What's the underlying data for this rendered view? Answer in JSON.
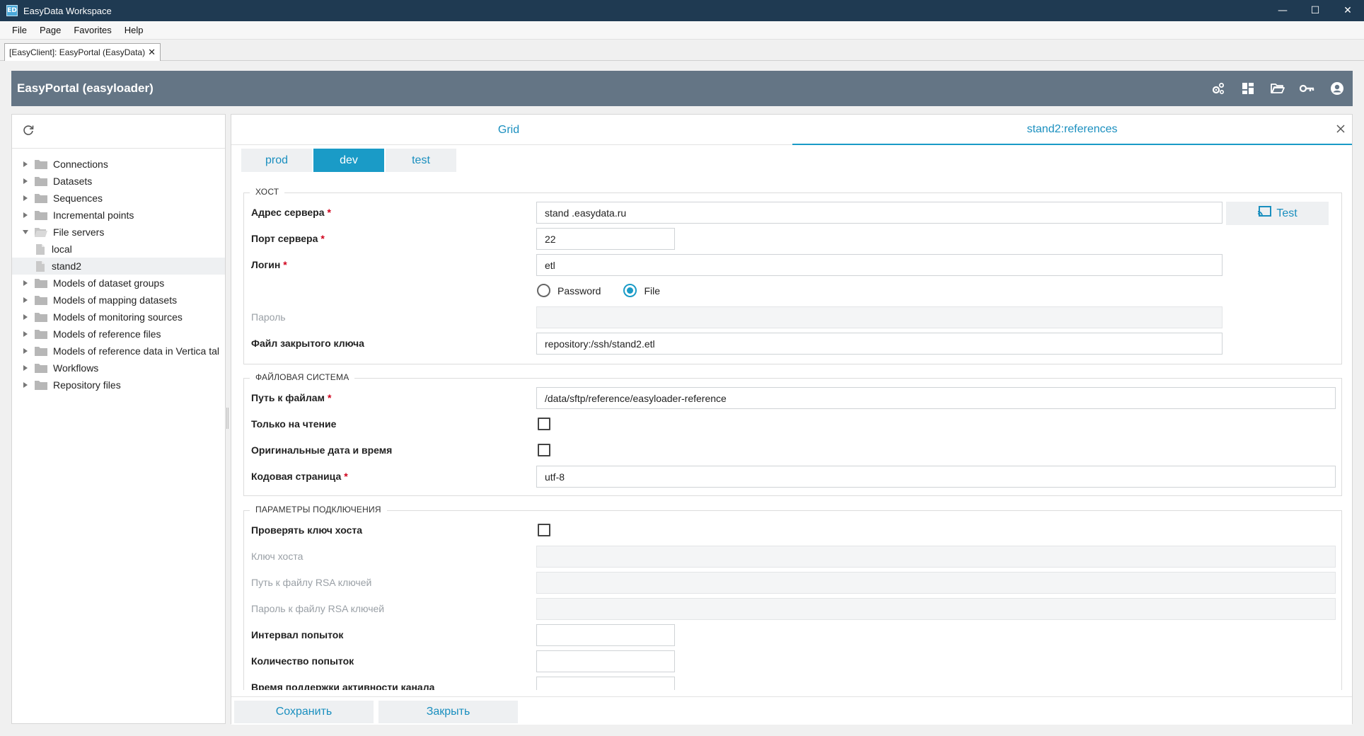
{
  "window": {
    "app_icon_text": "ED",
    "title": "EasyData Workspace",
    "minimize": "—",
    "maximize": "☐",
    "close": "✕"
  },
  "menu": [
    "File",
    "Page",
    "Favorites",
    "Help"
  ],
  "doc_tab": {
    "label": "[EasyClient]: EasyPortal (EasyData)",
    "close": "✕"
  },
  "header": {
    "title": "EasyPortal (easyloader)",
    "icons": [
      "settings-gears-icon",
      "dashboard-grid-icon",
      "folder-open-icon",
      "key-icon",
      "user-account-icon"
    ]
  },
  "tree": {
    "items": [
      {
        "label": "Connections",
        "expanded": false
      },
      {
        "label": "Datasets",
        "expanded": false
      },
      {
        "label": "Sequences",
        "expanded": false
      },
      {
        "label": "Incremental points",
        "expanded": false
      },
      {
        "label": "File servers",
        "expanded": true
      },
      {
        "label": "local",
        "child": true
      },
      {
        "label": "stand2",
        "child": true,
        "selected": true
      },
      {
        "label": "Models of dataset groups",
        "expanded": false
      },
      {
        "label": "Models of mapping datasets",
        "expanded": false
      },
      {
        "label": "Models of monitoring sources",
        "expanded": false
      },
      {
        "label": "Models of reference files",
        "expanded": false
      },
      {
        "label": "Models of reference data in Vertica tal",
        "expanded": false
      },
      {
        "label": "Workflows",
        "expanded": false
      },
      {
        "label": "Repository files",
        "expanded": false
      }
    ]
  },
  "view_tabs": {
    "grid": "Grid",
    "active": "stand2:references"
  },
  "env_tabs": [
    {
      "label": "prod",
      "active": false
    },
    {
      "label": "dev",
      "active": true
    },
    {
      "label": "test",
      "active": false
    }
  ],
  "host": {
    "legend": "ХОСТ",
    "server_address_label": "Адрес сервера",
    "server_address_value": "stand  .easydata.ru",
    "test_button": "Test",
    "port_label": "Порт сервера",
    "port_value": "22",
    "login_label": "Логин",
    "login_value": "etl",
    "auth_option_password": "Password",
    "auth_option_file": "File",
    "auth_selected": "File",
    "password_label": "Пароль",
    "private_key_label": "Файл закрытого ключа",
    "private_key_value": "repository:/ssh/stand2.etl"
  },
  "filesystem": {
    "legend": "ФАЙЛОВАЯ СИСТЕМА",
    "path_label": "Путь к файлам",
    "path_value": "/data/sftp/reference/easyloader-reference",
    "readonly_label": "Только на чтение",
    "readonly_checked": false,
    "original_datetime_label": "Оригинальные дата и время",
    "original_datetime_checked": false,
    "codepage_label": "Кодовая страница",
    "codepage_value": "utf-8"
  },
  "connection": {
    "legend": "ПАРАМЕТРЫ ПОДКЛЮЧЕНИЯ",
    "check_host_key_label": "Проверять ключ хоста",
    "check_host_key_checked": false,
    "host_key_label": "Ключ хоста",
    "rsa_path_label": "Путь к файлу RSA ключей",
    "rsa_password_label": "Пароль к файлу RSA ключей",
    "retry_interval_label": "Интервал попыток",
    "retry_count_label": "Количество попыток",
    "keepalive_label": "Время поддержки активности канала"
  },
  "footer": {
    "save": "Сохранить",
    "close": "Закрыть"
  },
  "colors": {
    "titlebar": "#1f3a52",
    "header": "#647585",
    "accent": "#1a9bc7",
    "required": "#d0021b"
  }
}
